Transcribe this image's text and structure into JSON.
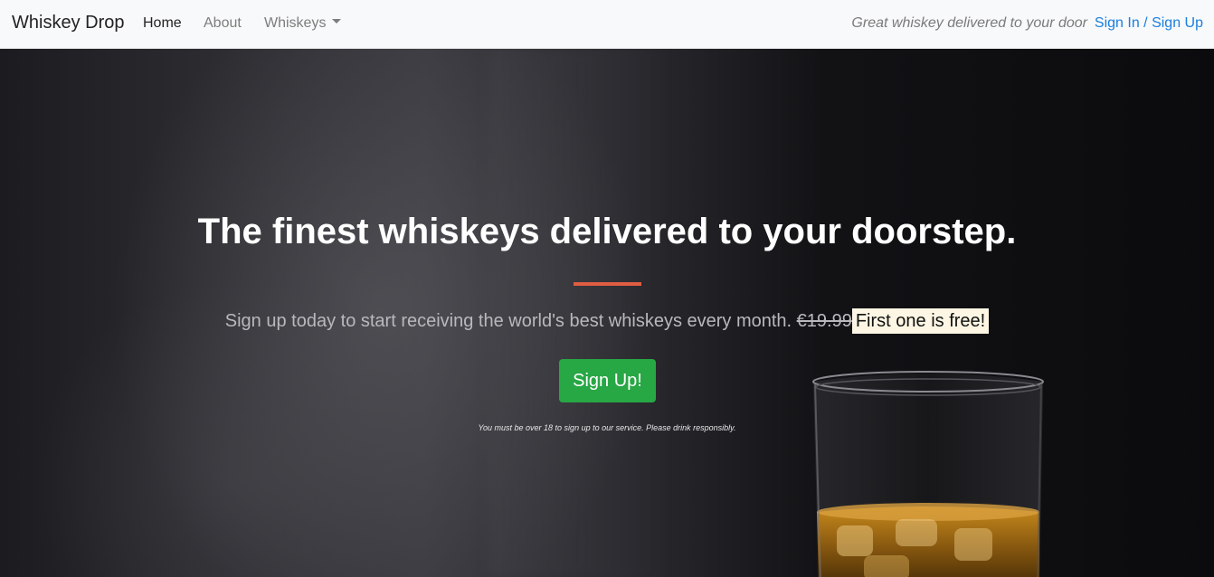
{
  "navbar": {
    "brand": "Whiskey Drop",
    "links": [
      {
        "label": "Home",
        "active": true
      },
      {
        "label": "About",
        "active": false
      },
      {
        "label": "Whiskeys",
        "active": false,
        "dropdown": true
      }
    ],
    "tagline": "Great whiskey delivered to your door",
    "auth_link": "Sign In / Sign Up"
  },
  "hero": {
    "headline": "The finest whiskeys delivered to your doorstep.",
    "subline": "Sign up today to start receiving the world's best whiskeys every month.",
    "old_price": "€19.99",
    "free_badge": "First one is free!",
    "cta_label": "Sign Up!",
    "disclaimer": "You must be over 18 to sign up to our service. Please drink responsibly."
  },
  "colors": {
    "accent_divider": "#e05d43",
    "cta_green": "#28a745",
    "link_blue": "#1a7fe0",
    "badge_bg": "#fdf6e4"
  },
  "icons": {
    "dropdown": "chevron-down-icon"
  }
}
